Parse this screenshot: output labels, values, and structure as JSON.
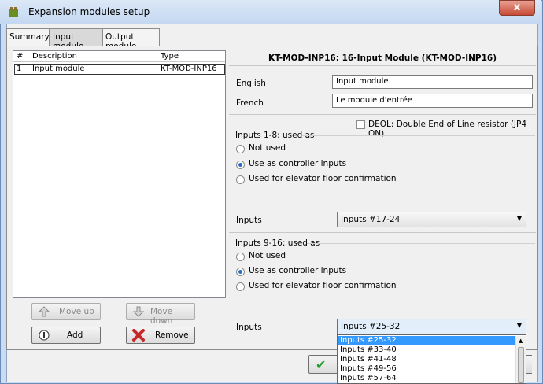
{
  "window": {
    "title": "Expansion modules setup",
    "close_label": "x"
  },
  "tabs": [
    {
      "label": "Summary"
    },
    {
      "label": "Input module"
    },
    {
      "label": "Output module"
    }
  ],
  "list": {
    "columns": [
      "#",
      "Description",
      "Type"
    ],
    "rows": [
      {
        "num": "1",
        "description": "Input module",
        "type": "KT-MOD-INP16"
      }
    ]
  },
  "buttons": {
    "move_up": "Move up",
    "move_down": "Move down",
    "add": "Add",
    "remove": "Remove",
    "ok_check": "✔"
  },
  "module_header": "KT-MOD-INP16: 16-Input Module (KT-MOD-INP16)",
  "names": {
    "english_label": "English",
    "english_value": "Input module",
    "french_label": "French",
    "french_value": "Le module d'entrée"
  },
  "deol": {
    "label": "DEOL: Double End of Line resistor (JP4 ON)",
    "checked": false
  },
  "group1": {
    "title": "Inputs 1-8: used as",
    "options": [
      "Not used",
      "Use as controller inputs",
      "Used for elevator floor confirmation"
    ],
    "selected_index": 1,
    "inputs_label": "Inputs",
    "inputs_value": "Inputs #17-24"
  },
  "group2": {
    "title": "Inputs 9-16: used as",
    "options": [
      "Not used",
      "Use as controller inputs",
      "Used for elevator floor confirmation"
    ],
    "selected_index": 1,
    "inputs_label": "Inputs",
    "inputs_value": "Inputs #25-32"
  },
  "dropdown": {
    "items": [
      "Inputs #25-32",
      "Inputs #33-40",
      "Inputs #41-48",
      "Inputs #49-56",
      "Inputs #57-64"
    ],
    "selected_index": 0
  },
  "colors": {
    "accent": "#3399ff",
    "radio_dot": "#2a6cc7",
    "remove_x": "#c62828",
    "ok_check": "#1f9d2b"
  }
}
